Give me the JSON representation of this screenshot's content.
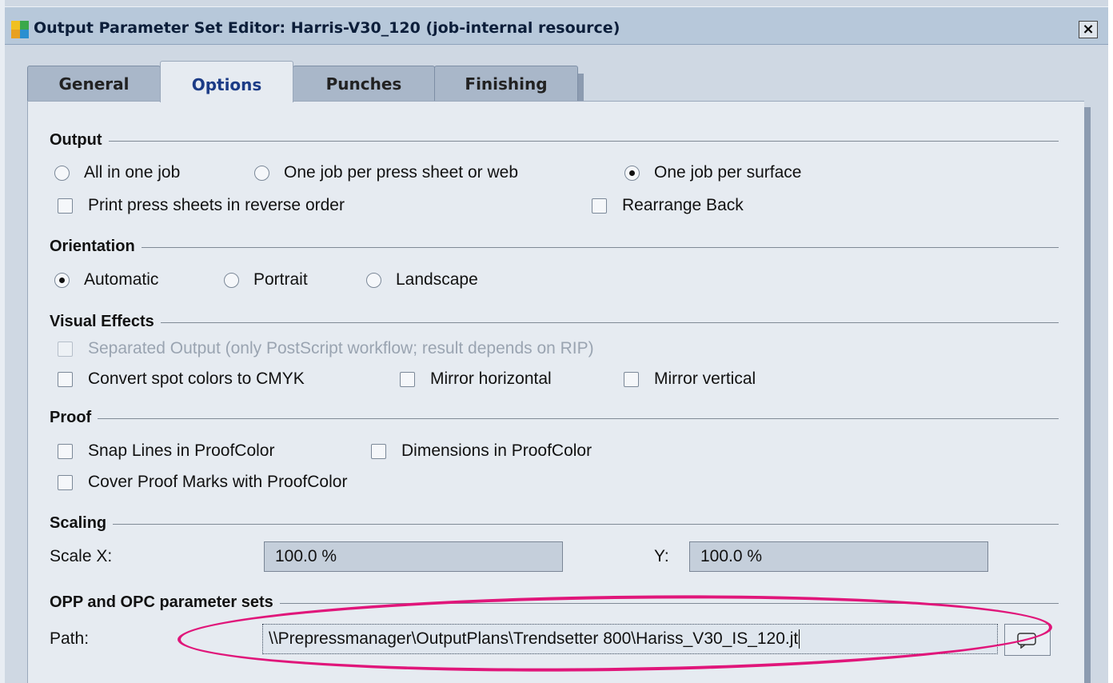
{
  "window": {
    "title": "Output Parameter Set Editor: Harris-V30_120 (job-internal resource)",
    "close_glyph": "×"
  },
  "tabs": [
    {
      "label": "General",
      "active": false
    },
    {
      "label": "Options",
      "active": true
    },
    {
      "label": "Punches",
      "active": false
    },
    {
      "label": "Finishing",
      "active": false
    }
  ],
  "output": {
    "title": "Output",
    "radio_all": "All in one job",
    "radio_sheet": "One job per press sheet or web",
    "radio_surface": "One job per surface",
    "selected": "One job per surface",
    "check_reverse": "Print press sheets in reverse order",
    "check_rearrange": "Rearrange Back"
  },
  "orientation": {
    "title": "Orientation",
    "radio_auto": "Automatic",
    "radio_portrait": "Portrait",
    "radio_landscape": "Landscape",
    "selected": "Automatic"
  },
  "visual_effects": {
    "title": "Visual Effects",
    "check_separated": "Separated Output (only PostScript workflow; result depends on RIP)",
    "check_spot": "Convert spot colors to CMYK",
    "check_mirror_h": "Mirror horizontal",
    "check_mirror_v": "Mirror vertical"
  },
  "proof": {
    "title": "Proof",
    "check_snap": "Snap Lines in ProofColor",
    "check_dimensions": "Dimensions in ProofColor",
    "check_cover": "Cover Proof Marks with ProofColor"
  },
  "scaling": {
    "title": "Scaling",
    "scale_x_label": "Scale X:",
    "scale_x_value": "100.0 %",
    "y_label": "Y:",
    "y_value": "100.0 %"
  },
  "opp": {
    "title": "OPP and OPC parameter sets",
    "path_label": "Path:",
    "path_value": "\\\\Prepressmanager\\OutputPlans\\Trendsetter 800\\Hariss_V30_IS_120.jt"
  },
  "colors": {
    "titlebar": "#b7c8da",
    "panel": "#e6ebf1",
    "active_tab_text": "#1b3b86",
    "highlight_annotation": "#e0167a"
  },
  "icons": {
    "app": "app-window-icon",
    "close": "close-icon",
    "browse": "folder-browse-icon"
  }
}
